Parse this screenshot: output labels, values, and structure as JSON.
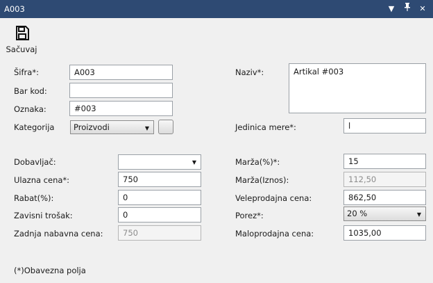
{
  "window": {
    "title": "A003",
    "dropdown_icon": "▾",
    "pin_icon": "📌",
    "close_icon": "✕"
  },
  "toolbar": {
    "save_label": "Sačuvaj",
    "save_icon": "floppy-disk-icon"
  },
  "form": {
    "sifra_label": "Šifra*:",
    "sifra_value": "A003",
    "barcode_label": "Bar kod:",
    "barcode_value": "",
    "oznaka_label": "Oznaka:",
    "oznaka_value": "#003",
    "kategorija_label": "Kategorija",
    "kategorija_value": "Proizvodi",
    "naziv_label": "Naziv*:",
    "naziv_value": "Artikal #003",
    "jedinica_label": "Jedinica mere*:",
    "jedinica_value": "l",
    "dobavljac_label": "Dobavljač:",
    "dobavljac_value": "",
    "ulazna_label": "Ulazna cena*:",
    "ulazna_value": "750",
    "rabat_label": "Rabat(%):",
    "rabat_value": "0",
    "zavisni_label": "Zavisni trošak:",
    "zavisni_value": "0",
    "zadnja_label": "Zadnja nabavna cena:",
    "zadnja_value": "750",
    "marza_pct_label": "Marža(%)*:",
    "marza_pct_value": "15",
    "marza_iznos_label": "Marža(Iznos):",
    "marza_iznos_value": "112,50",
    "veleprodajna_label": "Veleprodajna cena:",
    "veleprodajna_value": "862,50",
    "porez_label": "Porez*:",
    "porez_value": "20 %",
    "maloprodajna_label": "Maloprodajna cena:",
    "maloprodajna_value": "1035,00",
    "required_note": "(*)Obavezna polja"
  },
  "colors": {
    "titlebar": "#2e4a73",
    "background": "#f0f0f0"
  }
}
